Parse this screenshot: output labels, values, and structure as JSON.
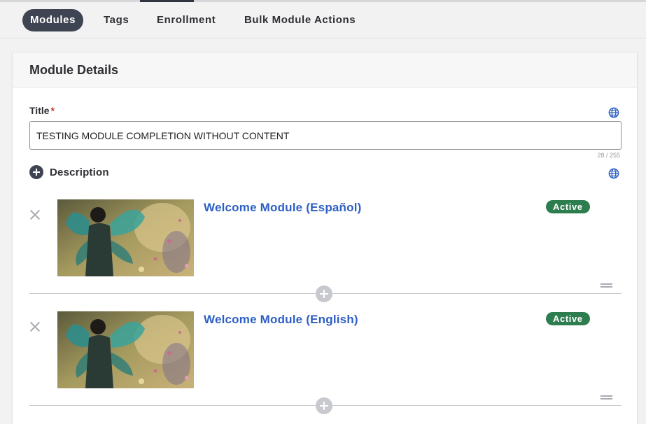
{
  "tabs": [
    {
      "label": "Modules",
      "active": true
    },
    {
      "label": "Tags",
      "active": false
    },
    {
      "label": "Enrollment",
      "active": false
    },
    {
      "label": "Bulk Module Actions",
      "active": false
    }
  ],
  "panel": {
    "title": "Module Details",
    "title_field": {
      "label": "Title",
      "required_mark": "*",
      "value": "TESTING MODULE COMPLETION WITHOUT CONTENT",
      "char_count": "28 / 255"
    },
    "description_label": "Description",
    "modules": [
      {
        "name": "Welcome Module (Español)",
        "status": "Active",
        "thumbnail": "fairy-wings-artwork"
      },
      {
        "name": "Welcome Module (English)",
        "status": "Active",
        "thumbnail": "fairy-wings-artwork"
      }
    ]
  },
  "colors": {
    "accent_link": "#2d5fc5",
    "active_badge": "#2e7d4f",
    "active_tab": "#3f4452",
    "required": "#c0392b"
  },
  "icons": {
    "translate": "globe-icon",
    "add": "plus-circle-icon",
    "remove": "close-icon",
    "reorder": "drag-handle-icon"
  }
}
